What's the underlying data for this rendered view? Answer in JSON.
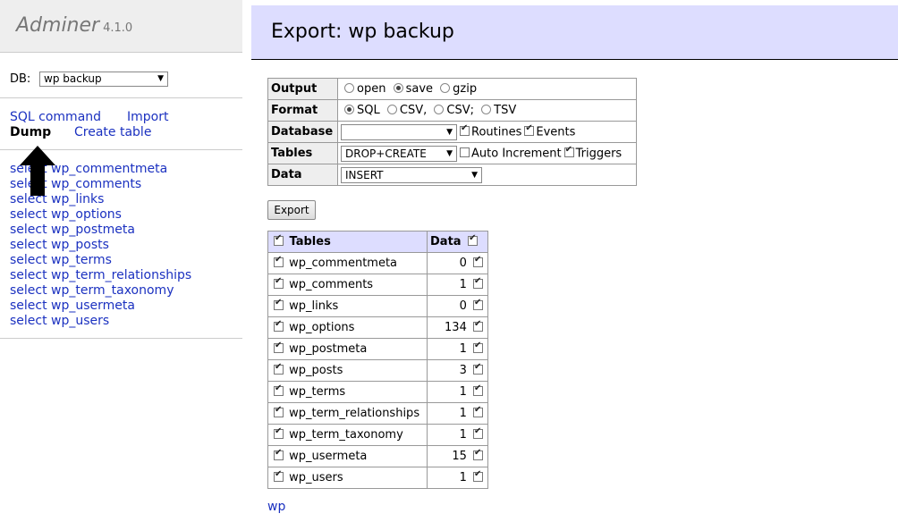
{
  "app": {
    "name": "Adminer",
    "version": "4.1.0"
  },
  "db": {
    "label": "DB:",
    "selected": "wp backup"
  },
  "menu_links": {
    "sql_command": "SQL command",
    "import": "Import",
    "dump": "Dump",
    "create_table": "Create table"
  },
  "table_links": [
    "select wp_commentmeta",
    "select wp_comments",
    "select wp_links",
    "select wp_options",
    "select wp_postmeta",
    "select wp_posts",
    "select wp_terms",
    "select wp_term_relationships",
    "select wp_term_taxonomy",
    "select wp_usermeta",
    "select wp_users"
  ],
  "title": "Export: wp backup",
  "form": {
    "output_label": "Output",
    "output_options": [
      "open",
      "save",
      "gzip"
    ],
    "format_label": "Format",
    "format_options": [
      "SQL",
      "CSV,",
      "CSV;",
      "TSV"
    ],
    "database_label": "Database",
    "database_value": "",
    "routines": "Routines",
    "events": "Events",
    "tables_label": "Tables",
    "tables_value": "DROP+CREATE",
    "auto_increment": "Auto Increment",
    "triggers": "Triggers",
    "data_label": "Data",
    "data_value": "INSERT"
  },
  "export_button": "Export",
  "list": {
    "tables_header": "Tables",
    "data_header": "Data",
    "rows": [
      {
        "name": "wp_commentmeta",
        "rows": "0"
      },
      {
        "name": "wp_comments",
        "rows": "1"
      },
      {
        "name": "wp_links",
        "rows": "0"
      },
      {
        "name": "wp_options",
        "rows": "134"
      },
      {
        "name": "wp_postmeta",
        "rows": "1"
      },
      {
        "name": "wp_posts",
        "rows": "3"
      },
      {
        "name": "wp_terms",
        "rows": "1"
      },
      {
        "name": "wp_term_relationships",
        "rows": "1"
      },
      {
        "name": "wp_term_taxonomy",
        "rows": "1"
      },
      {
        "name": "wp_usermeta",
        "rows": "15"
      },
      {
        "name": "wp_users",
        "rows": "1"
      }
    ]
  },
  "bottom_link": "wp",
  "colors": {
    "link": "#1b31c0",
    "header_bg": "#ddf",
    "menu_bg": "#eee"
  }
}
